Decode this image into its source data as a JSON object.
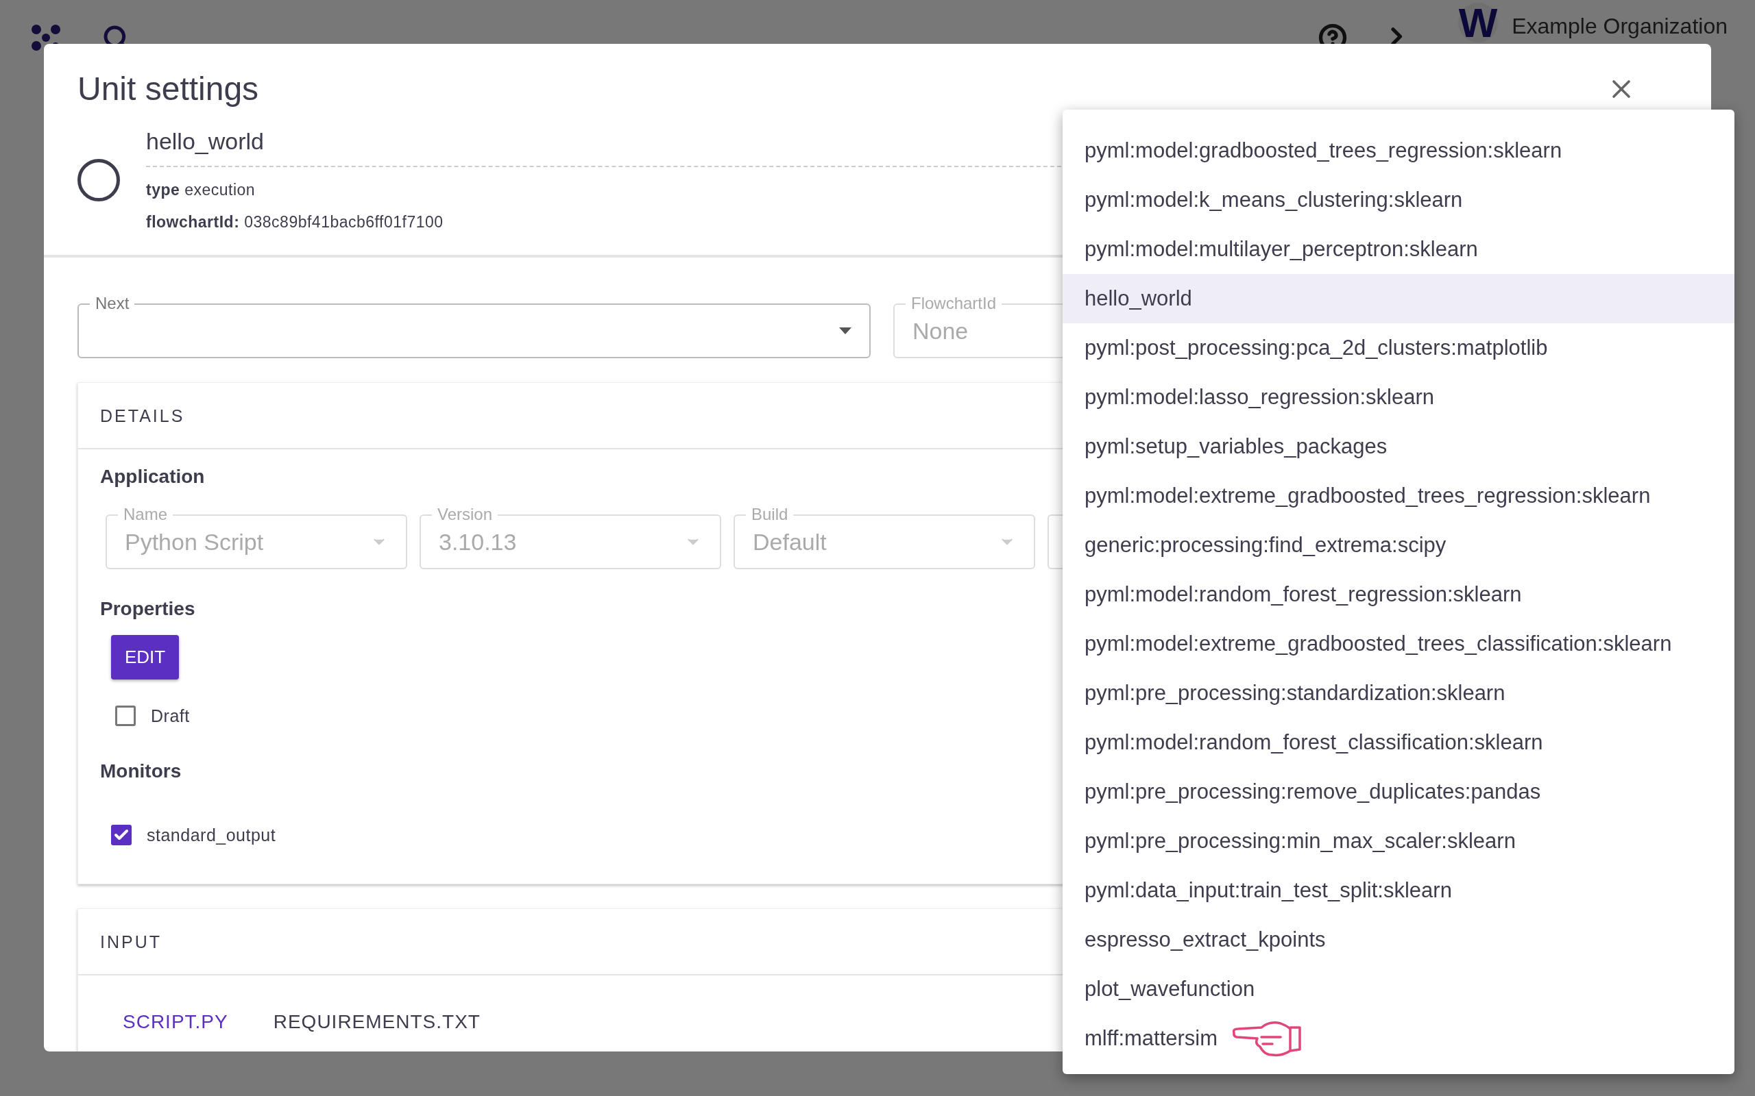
{
  "app_bar": {
    "organization": "Example Organization",
    "avatar_letter": "W"
  },
  "dialog": {
    "title": "Unit settings",
    "unit": {
      "name": "hello_world",
      "type_label": "type",
      "type": "execution",
      "flowchart_label": "flowchartId:",
      "flowchart_id": "038c89bf41bacb6ff01f7100"
    },
    "next_field": {
      "label": "Next"
    },
    "flowchart_field": {
      "label": "FlowchartId",
      "value": "None"
    },
    "details": {
      "header": "DETAILS",
      "application_heading": "Application",
      "app_fields": [
        {
          "label": "Name",
          "value": "Python Script"
        },
        {
          "label": "Version",
          "value": "3.10.13"
        },
        {
          "label": "Build",
          "value": "Default"
        }
      ],
      "properties_heading": "Properties",
      "edit_button": "EDIT",
      "draft": {
        "label": "Draft",
        "checked": false
      },
      "monitors_heading": "Monitors",
      "monitors": [
        {
          "label": "standard_output",
          "checked": true
        }
      ]
    },
    "input": {
      "header": "INPUT",
      "tabs": [
        {
          "label": "SCRIPT.PY",
          "selected": true
        },
        {
          "label": "REQUIREMENTS.TXT",
          "selected": false
        }
      ]
    }
  },
  "dropdown": {
    "options": [
      {
        "label": "pyml:model:gradboosted_trees_regression:sklearn",
        "selected": false
      },
      {
        "label": "pyml:model:k_means_clustering:sklearn",
        "selected": false
      },
      {
        "label": "pyml:model:multilayer_perceptron:sklearn",
        "selected": false
      },
      {
        "label": "hello_world",
        "selected": true
      },
      {
        "label": "pyml:post_processing:pca_2d_clusters:matplotlib",
        "selected": false
      },
      {
        "label": "pyml:model:lasso_regression:sklearn",
        "selected": false
      },
      {
        "label": "pyml:setup_variables_packages",
        "selected": false
      },
      {
        "label": "pyml:model:extreme_gradboosted_trees_regression:sklearn",
        "selected": false
      },
      {
        "label": "generic:processing:find_extrema:scipy",
        "selected": false
      },
      {
        "label": "pyml:model:random_forest_regression:sklearn",
        "selected": false
      },
      {
        "label": "pyml:model:extreme_gradboosted_trees_classification:sklearn",
        "selected": false
      },
      {
        "label": "pyml:pre_processing:standardization:sklearn",
        "selected": false
      },
      {
        "label": "pyml:model:random_forest_classification:sklearn",
        "selected": false
      },
      {
        "label": "pyml:pre_processing:remove_duplicates:pandas",
        "selected": false
      },
      {
        "label": "pyml:pre_processing:min_max_scaler:sklearn",
        "selected": false
      },
      {
        "label": "pyml:data_input:train_test_split:sklearn",
        "selected": false
      },
      {
        "label": "espresso_extract_kpoints",
        "selected": false
      },
      {
        "label": "plot_wavefunction",
        "selected": false
      },
      {
        "label": "mlff:mattersim",
        "selected": false,
        "pointer": true
      }
    ]
  }
}
